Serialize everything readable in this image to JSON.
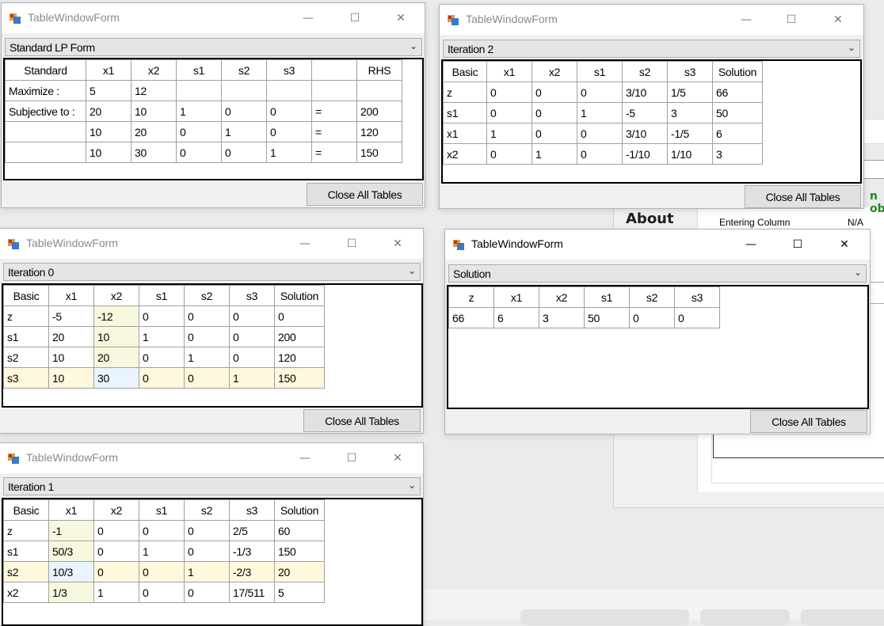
{
  "window_title": "TableWindowForm",
  "close_all_label": "Close All Tables",
  "colors": {
    "row_highlight": "#fff8dd",
    "col_highlight": "#f8f8df",
    "pivot_highlight": "#eaf4ff"
  },
  "background_app": {
    "about_label": "About",
    "entering_column_label": "Entering Column",
    "entering_column_value": "N/A",
    "objective_fragment": "n ob"
  },
  "windows": {
    "standard": {
      "selector": "Standard LP Form",
      "headers": [
        "Standard",
        "x1",
        "x2",
        "s1",
        "s2",
        "s3",
        "",
        "RHS"
      ],
      "rows": [
        [
          "Maximize :",
          "5",
          "12",
          "",
          "",
          "",
          "",
          ""
        ],
        [
          "Subjective to :",
          "20",
          "10",
          "1",
          "0",
          "0",
          "=",
          "200"
        ],
        [
          "",
          "10",
          "20",
          "0",
          "1",
          "0",
          "=",
          "120"
        ],
        [
          "",
          "10",
          "30",
          "0",
          "0",
          "1",
          "=",
          "150"
        ]
      ]
    },
    "iteration2": {
      "selector": "Iteration 2",
      "headers": [
        "Basic",
        "x1",
        "x2",
        "s1",
        "s2",
        "s3",
        "Solution"
      ],
      "rows": [
        [
          "z",
          "0",
          "0",
          "0",
          "3/10",
          "1/5",
          "66"
        ],
        [
          "s1",
          "0",
          "0",
          "1",
          "-5",
          "3",
          "50"
        ],
        [
          "x1",
          "1",
          "0",
          "0",
          "3/10",
          "-1/5",
          "6"
        ],
        [
          "x2",
          "0",
          "1",
          "0",
          "-1/10",
          "1/10",
          "3"
        ]
      ]
    },
    "iteration0": {
      "selector": "Iteration 0",
      "headers": [
        "Basic",
        "x1",
        "x2",
        "s1",
        "s2",
        "s3",
        "Solution"
      ],
      "rows": [
        [
          "z",
          "-5",
          "-12",
          "0",
          "0",
          "0",
          "0"
        ],
        [
          "s1",
          "20",
          "10",
          "1",
          "0",
          "0",
          "200"
        ],
        [
          "s2",
          "10",
          "20",
          "0",
          "1",
          "0",
          "120"
        ],
        [
          "s3",
          "10",
          "30",
          "0",
          "0",
          "1",
          "150"
        ]
      ]
    },
    "solution": {
      "selector": "Solution",
      "headers": [
        "z",
        "x1",
        "x2",
        "s1",
        "s2",
        "s3"
      ],
      "rows": [
        [
          "66",
          "6",
          "3",
          "50",
          "0",
          "0"
        ]
      ]
    },
    "iteration1": {
      "selector": "Iteration 1",
      "headers": [
        "Basic",
        "x1",
        "x2",
        "s1",
        "s2",
        "s3",
        "Solution"
      ],
      "rows": [
        [
          "z",
          "-1",
          "0",
          "0",
          "0",
          "2/5",
          "60"
        ],
        [
          "s1",
          "50/3",
          "0",
          "1",
          "0",
          "-1/3",
          "150"
        ],
        [
          "s2",
          "10/3",
          "0",
          "0",
          "1",
          "-2/3",
          "20"
        ],
        [
          "x2",
          "1/3",
          "1",
          "0",
          "0",
          "17/511",
          "5"
        ]
      ]
    }
  }
}
